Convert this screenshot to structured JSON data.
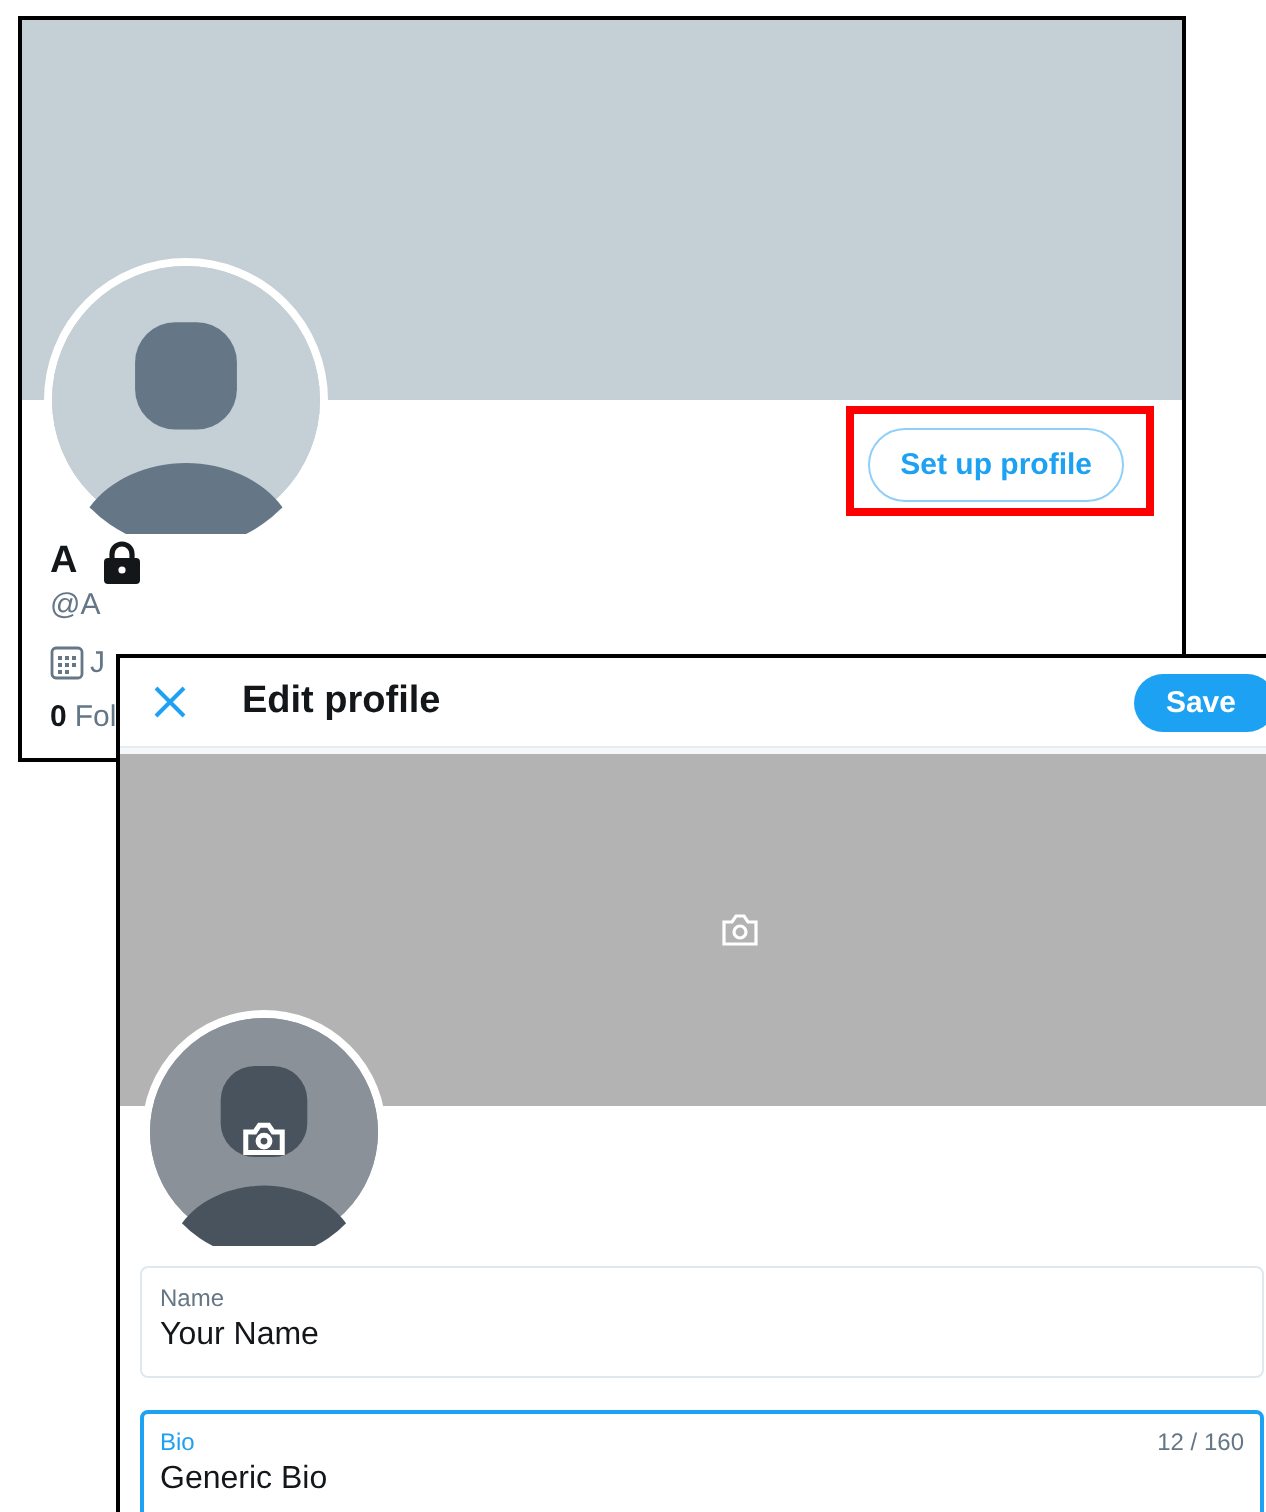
{
  "profile": {
    "name": "A",
    "protected": true,
    "handle": "@A",
    "joined": "J",
    "following_count": "0",
    "following_label": "Fol",
    "setup_button": "Set up profile",
    "highlighted": true
  },
  "edit_dialog": {
    "title": "Edit profile",
    "save_button": "Save",
    "fields": [
      {
        "label": "Name",
        "value": "Your Name",
        "focused": false
      },
      {
        "label": "Bio",
        "value": "Generic Bio",
        "counter": "12 / 160",
        "focused": true
      }
    ]
  }
}
